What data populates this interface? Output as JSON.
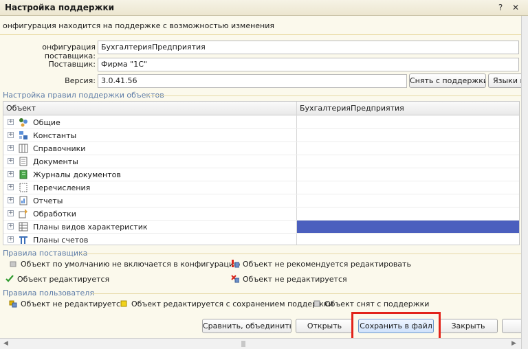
{
  "window": {
    "title": "Настройка поддержки",
    "help_glyph": "?",
    "close_glyph": "✕"
  },
  "status_text": "онфигурация находится на поддержке с возможностью изменения",
  "fields": {
    "vendor_config": {
      "label": "онфигурация поставщика:",
      "value": "БухгалтерияПредприятия"
    },
    "vendor": {
      "label": "Поставщик:",
      "value": "Фирма \"1С\""
    },
    "version": {
      "label": "Версия:",
      "value": "3.0.41.56"
    }
  },
  "top_buttons": {
    "remove_support": "Снять с поддержки",
    "languages": "Языки к"
  },
  "rules_group": {
    "title": "Настройка правил поддержки объектов"
  },
  "table": {
    "columns": [
      "Объект",
      "БухгалтерияПредприятия"
    ],
    "rows": [
      {
        "label": "Общие",
        "icon": "common-icon",
        "selected": false
      },
      {
        "label": "Константы",
        "icon": "constants-icon",
        "selected": false
      },
      {
        "label": "Справочники",
        "icon": "catalogs-icon",
        "selected": false
      },
      {
        "label": "Документы",
        "icon": "documents-icon",
        "selected": false
      },
      {
        "label": "Журналы документов",
        "icon": "document-journals-icon",
        "selected": false
      },
      {
        "label": "Перечисления",
        "icon": "enumerations-icon",
        "selected": false
      },
      {
        "label": "Отчеты",
        "icon": "reports-icon",
        "selected": false
      },
      {
        "label": "Обработки",
        "icon": "data-processors-icon",
        "selected": false
      },
      {
        "label": "Планы видов характеристик",
        "icon": "chart-of-characteristic-types-icon",
        "selected": true
      },
      {
        "label": "Планы счетов",
        "icon": "chart-of-accounts-icon",
        "selected": false
      }
    ]
  },
  "vendor_rules": {
    "title": "Правила поставщика",
    "items": [
      "Объект по умолчанию не включается в конфигурацию",
      "Объект не рекомендуется редактировать",
      "Объект редактируется",
      "Объект не редактируется"
    ]
  },
  "user_rules": {
    "title": "Правила пользователя",
    "items": [
      "Объект не редактируется",
      "Объект редактируется с сохранением поддержки",
      "Объект снят с поддержки"
    ]
  },
  "bottom_buttons": {
    "compare_merge": "Сравнить, объединить",
    "open": "Открыть",
    "save_to_file": "Сохранить в файл",
    "close": "Закрыть"
  },
  "colors": {
    "selection": "#4b5fbe",
    "highlight_frame": "#e2231a",
    "group_title": "#5b7aa6"
  }
}
